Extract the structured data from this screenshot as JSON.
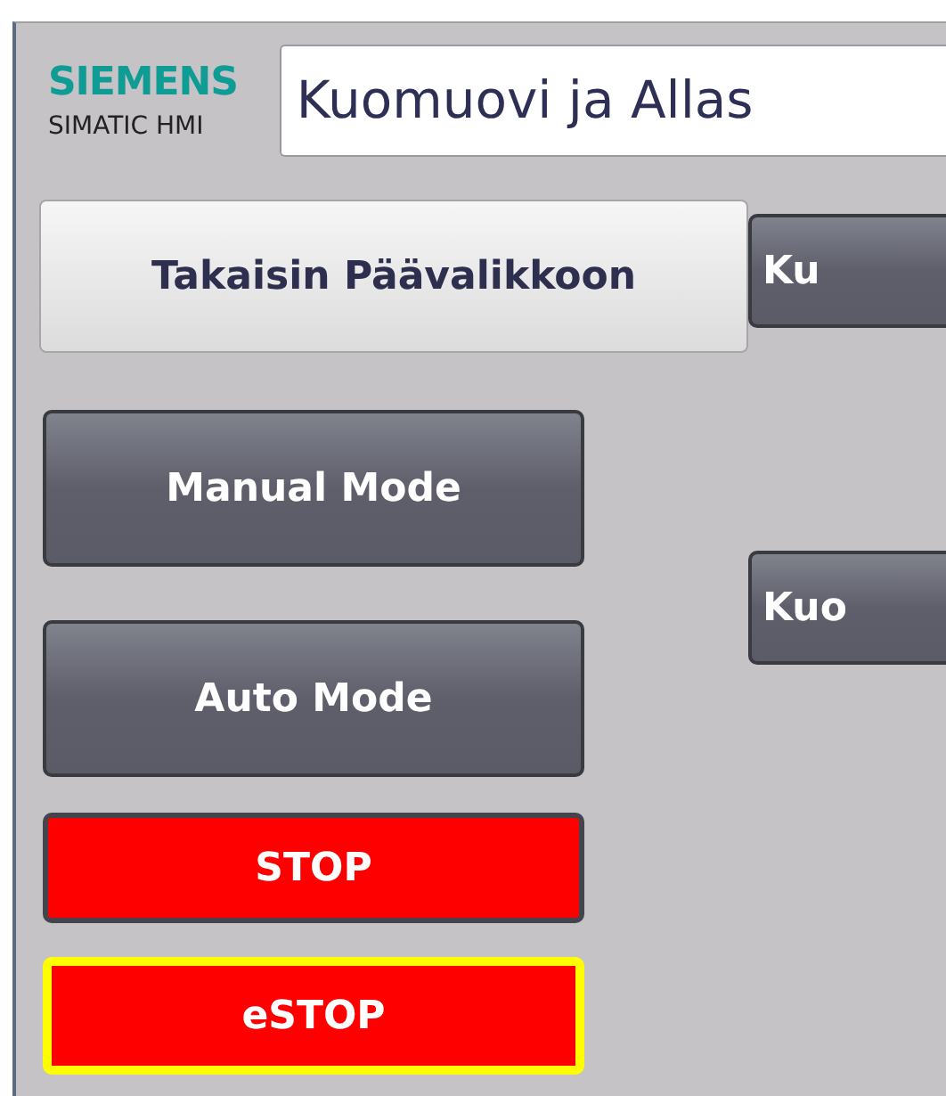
{
  "logo": {
    "brand": "SIEMENS",
    "product": "SIMATIC HMI"
  },
  "title": "Kuomuovi ja Allas",
  "left_buttons": [
    {
      "label": "Takaisin Päävalikkoon",
      "kind": "light"
    },
    {
      "label": "Manual Mode",
      "kind": "dark"
    },
    {
      "label": "Auto Mode",
      "kind": "dark"
    },
    {
      "label": "STOP",
      "kind": "alarm"
    },
    {
      "label": "eSTOP",
      "kind": "emergency"
    }
  ],
  "right_buttons": [
    {
      "label": "Ku",
      "kind": "dark"
    },
    {
      "label": "Kuo",
      "kind": "dark"
    }
  ]
}
